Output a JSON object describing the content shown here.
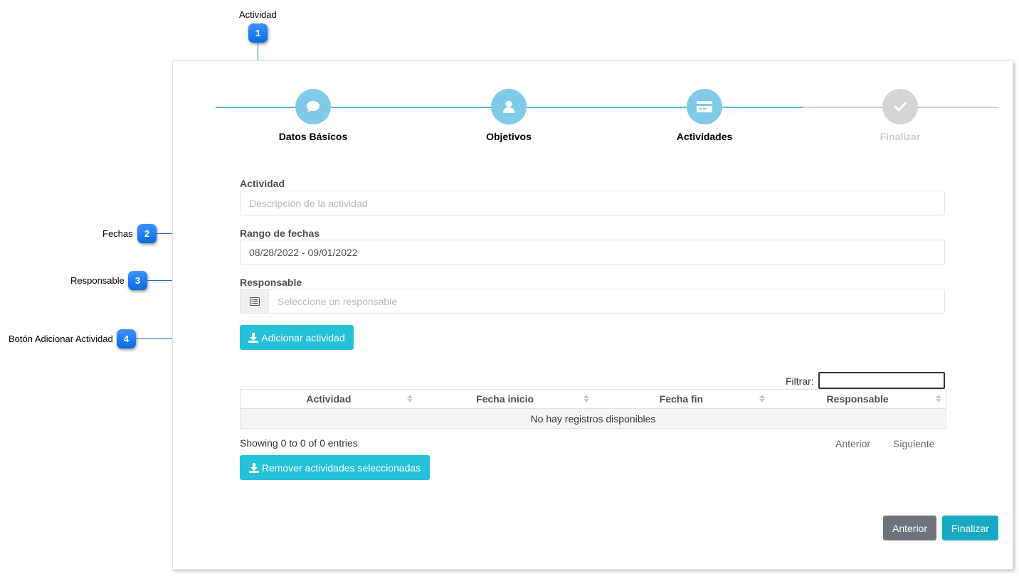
{
  "callouts": [
    {
      "number": "1",
      "label": "Actividad"
    },
    {
      "number": "2",
      "label": "Fechas"
    },
    {
      "number": "3",
      "label": "Responsable"
    },
    {
      "number": "4",
      "label": "Botón Adicionar Actividad"
    }
  ],
  "stepper": {
    "steps": [
      {
        "label": "Datos Básicos",
        "icon": "comment-icon",
        "state": "active"
      },
      {
        "label": "Objetivos",
        "icon": "user-icon",
        "state": "active"
      },
      {
        "label": "Actividades",
        "icon": "credit-card-icon",
        "state": "active"
      },
      {
        "label": "Finalizar",
        "icon": "check-icon",
        "state": "inactive"
      }
    ],
    "colors": {
      "active": "#7fcbe8",
      "inactive": "#d5d5d5",
      "track_active": "#5fb4e0",
      "track_inactive": "#d0d0d0"
    }
  },
  "form": {
    "actividad_label": "Actividad",
    "actividad_placeholder": "Descripción de la actividad",
    "fechas_label": "Rango de fechas",
    "fechas_value": "08/28/2022 - 09/01/2022",
    "responsable_label": "Responsable",
    "responsable_placeholder": "Seleccione un responsable",
    "responsable_icon": "list-icon",
    "add_button": "Adicionar actividad",
    "add_button_icon": "download-icon"
  },
  "table": {
    "filter_label": "Filtrar:",
    "columns": [
      "Actividad",
      "Fecha inicio",
      "Fecha fin",
      "Responsable"
    ],
    "empty_message": "No hay registros disponibles",
    "info": "Showing 0 to 0 of 0 entries",
    "prev_label": "Anterior",
    "next_label": "Siguiente"
  },
  "remove_button": "Remover actividades seleccionadas",
  "footer": {
    "prev_button": "Anterior",
    "finish_button": "Finalizar"
  },
  "colors": {
    "info_button": "#25c1d8",
    "secondary_button": "#6c757d",
    "callout_badge": "#1a7cf0"
  }
}
